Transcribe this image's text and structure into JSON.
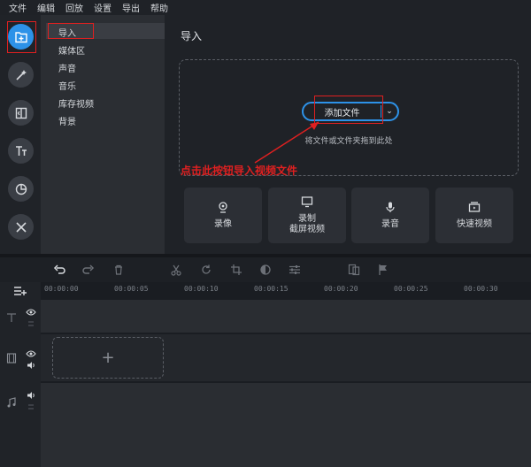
{
  "menu": [
    "文件",
    "编辑",
    "回放",
    "设置",
    "导出",
    "帮助"
  ],
  "toolbar_icons": [
    "import-folder-icon",
    "magic-wand-icon",
    "transition-icon",
    "text-icon",
    "sticker-icon",
    "tools-icon"
  ],
  "sidebar": {
    "items": [
      {
        "label": "导入"
      },
      {
        "label": "媒体区"
      },
      {
        "label": "声音"
      },
      {
        "label": "音乐"
      },
      {
        "label": "库存视频"
      },
      {
        "label": "背景"
      }
    ]
  },
  "main": {
    "title": "导入",
    "add_button": "添加文件",
    "drop_hint": "将文件或文件夹拖到此处",
    "annotation": "点击此按钮导入视频文件",
    "cards": [
      {
        "label": "录像",
        "icon": "webcam-icon"
      },
      {
        "label": "录制\n截屏视频",
        "icon": "screen-record-icon"
      },
      {
        "label": "录音",
        "icon": "microphone-icon"
      },
      {
        "label": "快速视频",
        "icon": "quick-video-icon"
      }
    ]
  },
  "timeline": {
    "ticks": [
      "00:00:00",
      "00:00:05",
      "00:00:10",
      "00:00:15",
      "00:00:20",
      "00:00:25",
      "00:00:30"
    ],
    "add_symbol": "+"
  },
  "colors": {
    "accent": "#2d92e8",
    "annotation": "#e02020"
  }
}
